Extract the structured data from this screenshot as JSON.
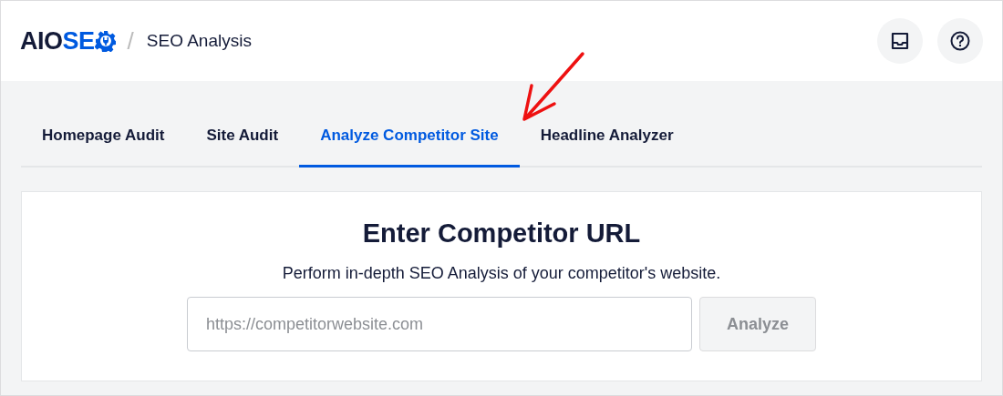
{
  "header": {
    "logo": {
      "dark": "AIO",
      "accent": "SE"
    },
    "separator": "/",
    "breadcrumb": "SEO Analysis"
  },
  "tabs": [
    {
      "label": "Homepage Audit",
      "selected": false
    },
    {
      "label": "Site Audit",
      "selected": false
    },
    {
      "label": "Analyze Competitor Site",
      "selected": true
    },
    {
      "label": "Headline Analyzer",
      "selected": false
    }
  ],
  "card": {
    "title": "Enter Competitor URL",
    "description": "Perform in-depth SEO Analysis of your competitor's website.",
    "url_field": {
      "placeholder": "https://competitorwebsite.com"
    },
    "button": {
      "label": "Analyze",
      "disabled": true
    }
  }
}
